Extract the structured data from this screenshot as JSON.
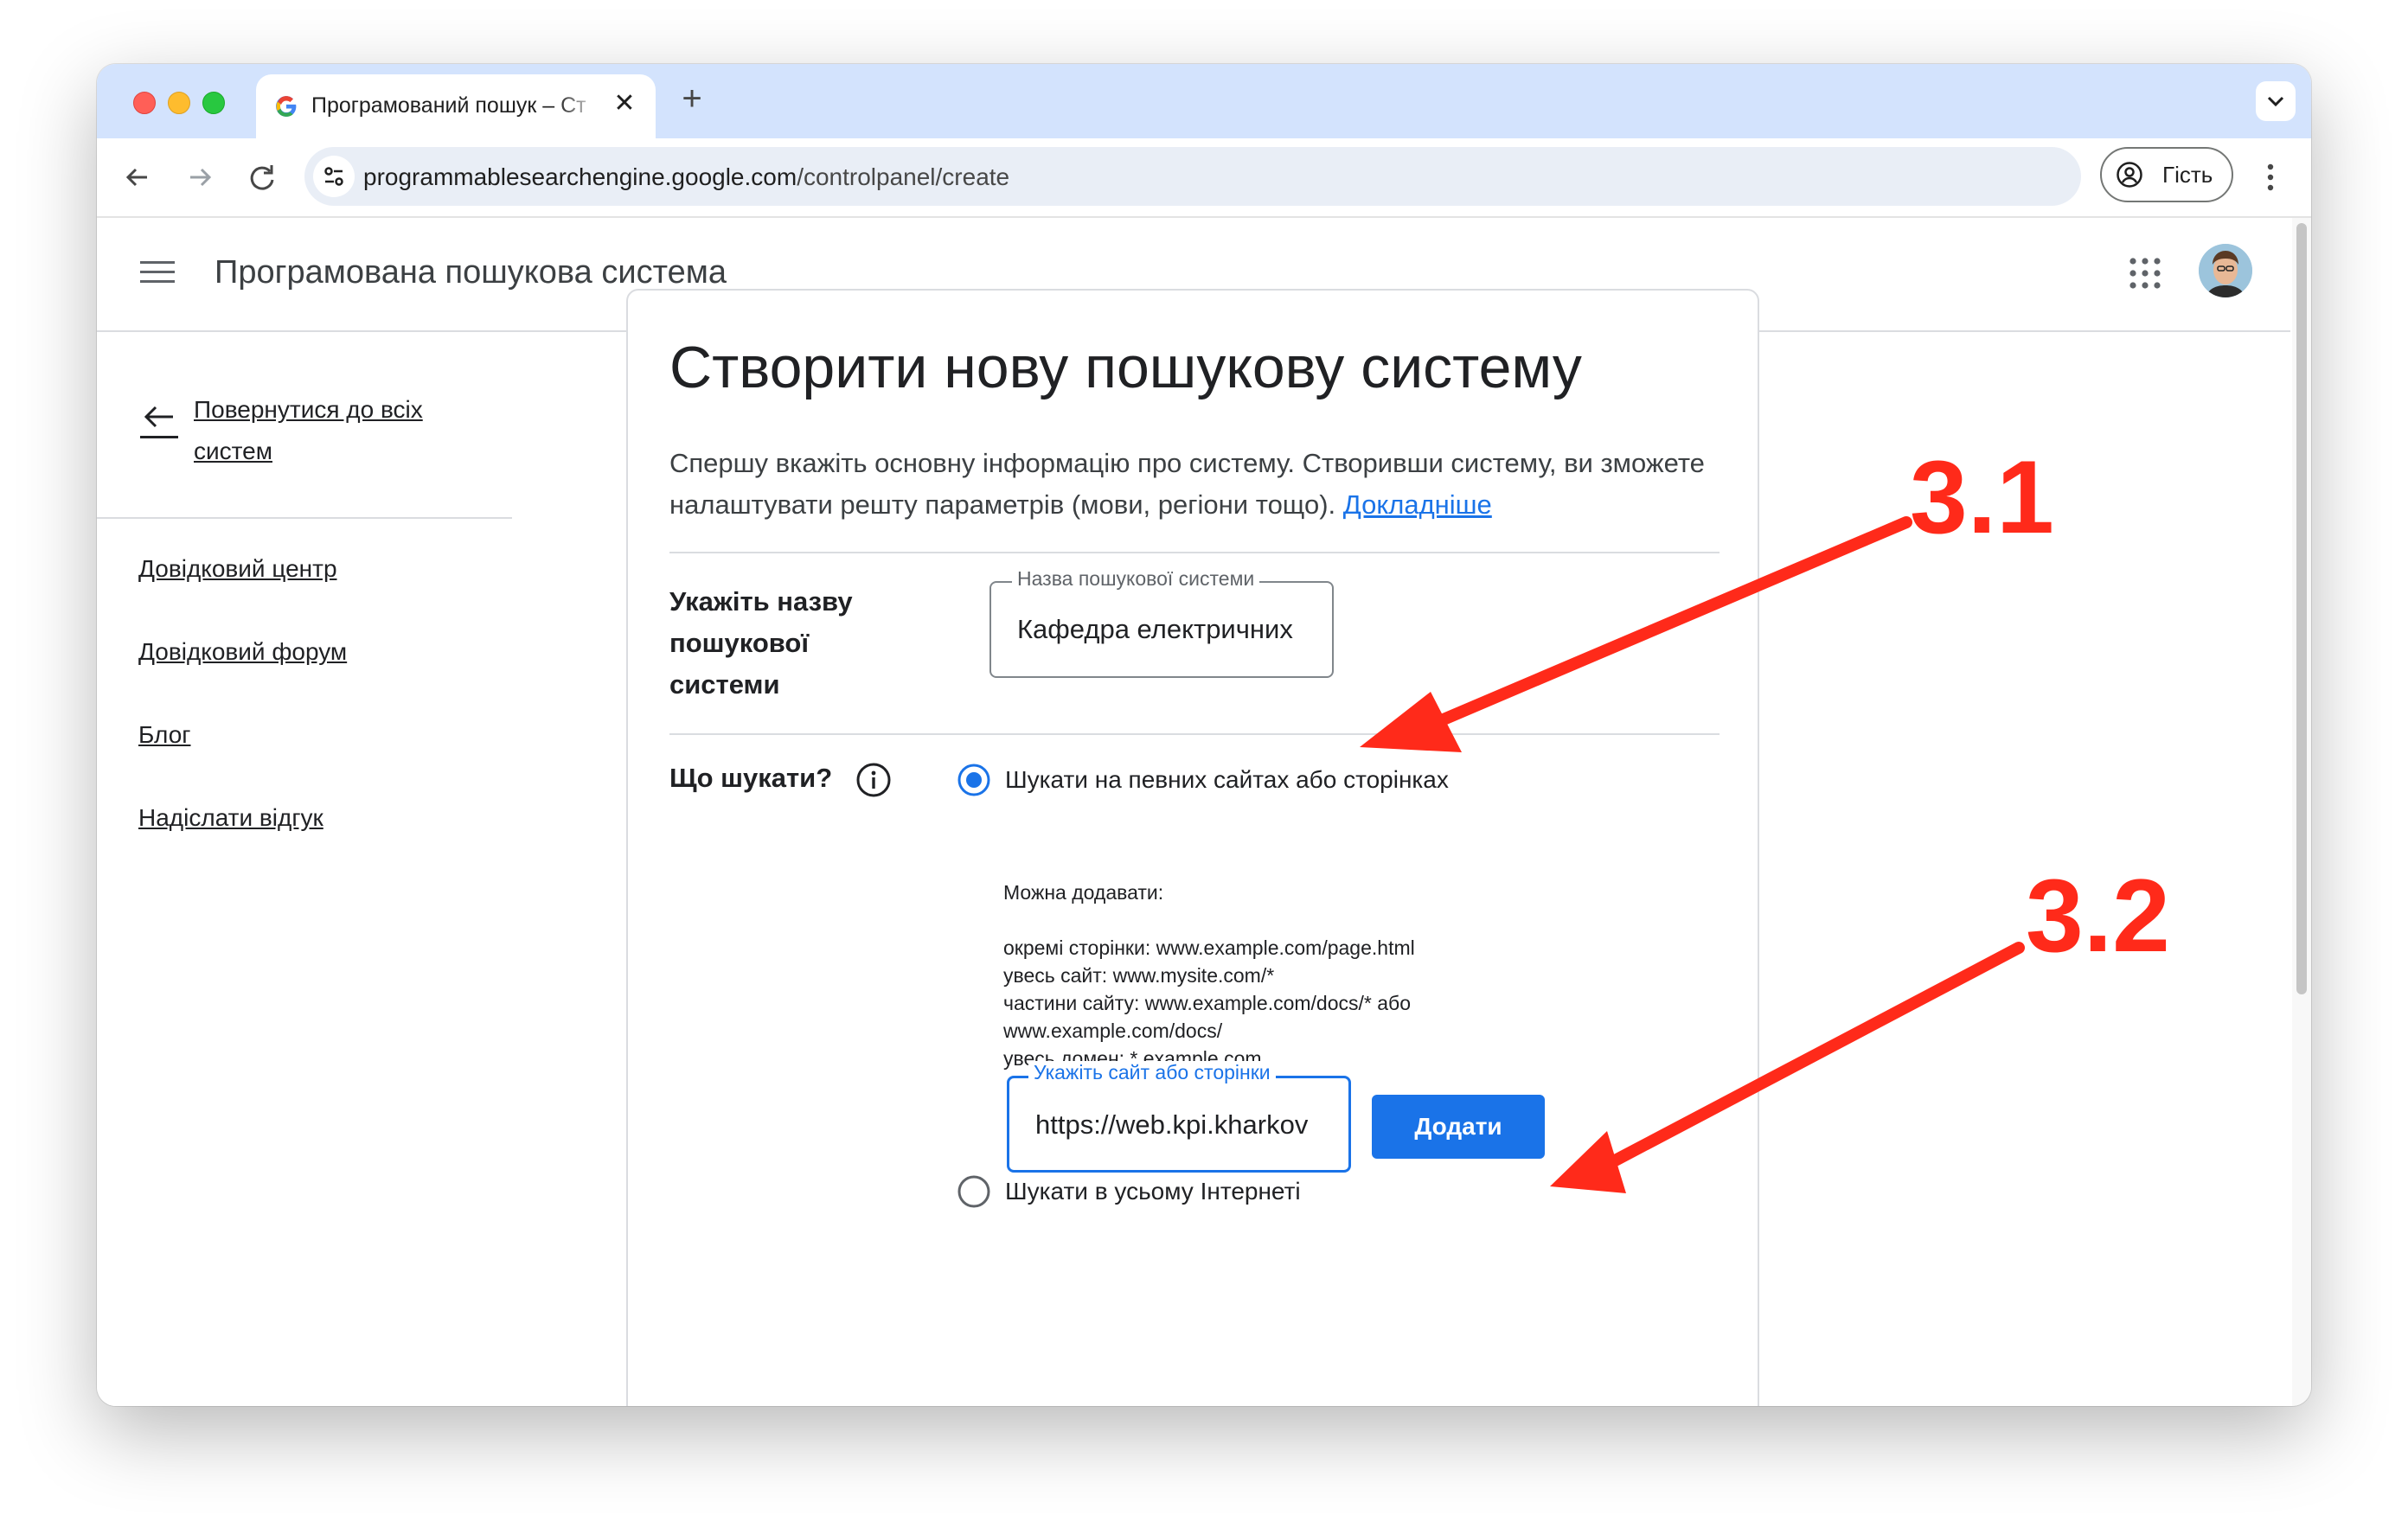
{
  "browser": {
    "tab_title": "Програмований пошук – Ст",
    "new_tab_symbol": "+",
    "close_symbol": "✕",
    "url_host": "programmablesearchengine.google.com",
    "url_path": "/controlpanel/create",
    "guest_label": "Гість"
  },
  "app": {
    "title": "Програмована пошукова система"
  },
  "sidebar": {
    "back_link": "Повернутися до всіх систем",
    "links": [
      "Довідковий центр",
      "Довідковий форум",
      "Блог",
      "Надіслати відгук"
    ]
  },
  "form": {
    "title": "Створити нову пошукову систему",
    "description": "Спершу вкажіть основну інформацію про систему. Створивши систему, ви зможете налаштувати решту параметрів (мови, регіони тощо). ",
    "learn_more": "Докладніше",
    "name_label": "Укажіть назву пошукової системи",
    "name_field_label": "Назва пошукової системи",
    "name_field_value": "Кафедра електричних",
    "what_label": "Що шукати?",
    "option_specific": "Шукати на певних сайтах або сторінках",
    "help_lines": [
      "Можна додавати:",
      "",
      "окремі сторінки: www.example.com/page.html",
      "увесь сайт: www.mysite.com/*",
      "частини сайту: www.example.com/docs/* або",
      "www.example.com/docs/",
      "увесь домен: *.example.com"
    ],
    "site_field_label": "Укажіть сайт або сторінки",
    "site_field_value": "https://web.kpi.kharkov",
    "add_button": "Додати",
    "option_all": "Шукати в усьому Інтернеті",
    "selected_option": "specific"
  },
  "annotations": {
    "label_1": "3.1",
    "label_2": "3.2",
    "color": "#ff2a1a"
  },
  "colors": {
    "accent": "#1a73e8",
    "titlebar": "#d3e3fd"
  }
}
